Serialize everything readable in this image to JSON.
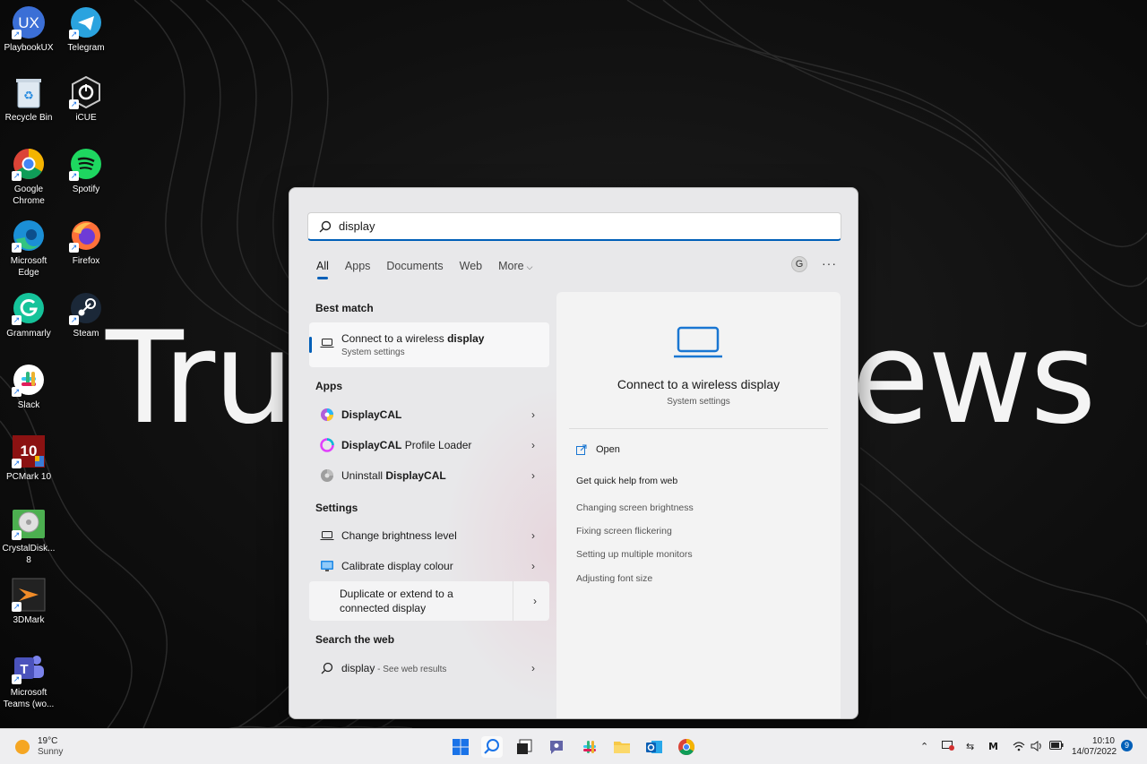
{
  "desktop": {
    "wallpaper_text_left": "Trus",
    "wallpaper_text_right": "ews",
    "icons": [
      {
        "label": "PlaybookUX",
        "icon": "playbookux-icon"
      },
      {
        "label": "Telegram",
        "icon": "telegram-icon"
      },
      {
        "label": "Recycle Bin",
        "icon": "recycle-bin-icon"
      },
      {
        "label": "iCUE",
        "icon": "icue-icon"
      },
      {
        "label": "Google Chrome",
        "icon": "chrome-icon"
      },
      {
        "label": "Spotify",
        "icon": "spotify-icon"
      },
      {
        "label": "Microsoft Edge",
        "icon": "edge-icon"
      },
      {
        "label": "Firefox",
        "icon": "firefox-icon"
      },
      {
        "label": "Grammarly",
        "icon": "grammarly-icon"
      },
      {
        "label": "Steam",
        "icon": "steam-icon"
      },
      {
        "label": "Slack",
        "icon": "slack-icon"
      },
      {
        "label": "PCMark 10",
        "icon": "pcmark-icon"
      },
      {
        "label": "CrystalDisk... 8",
        "icon": "crystaldisk-icon"
      },
      {
        "label": "3DMark",
        "icon": "3dmark-icon"
      },
      {
        "label": "Microsoft Teams (wo...",
        "icon": "teams-icon"
      }
    ],
    "playbook_mark": "UX",
    "pcmark_mark": "10"
  },
  "search": {
    "query": "display",
    "tabs": [
      "All",
      "Apps",
      "Documents",
      "Web",
      "More"
    ],
    "user_initial": "G",
    "more_dots": "···"
  },
  "results": {
    "best_match_header": "Best match",
    "best_match": {
      "title_prefix": "Connect to a wireless ",
      "title_bold": "display",
      "subtitle": "System settings"
    },
    "apps_header": "Apps",
    "apps": [
      {
        "bold": "DisplayCAL",
        "rest": "",
        "prefix": ""
      },
      {
        "bold": "DisplayCAL",
        "rest": " Profile Loader",
        "prefix": ""
      },
      {
        "bold": "DisplayCAL",
        "rest": "",
        "prefix": "Uninstall "
      }
    ],
    "settings_header": "Settings",
    "settings": [
      {
        "label": "Change brightness level"
      },
      {
        "label": "Calibrate display colour"
      }
    ],
    "duplicate": {
      "line1": "Duplicate or extend to a",
      "line2": "connected display"
    },
    "web_header": "Search the web",
    "web": {
      "query": "display",
      "suffix": " - See web results"
    }
  },
  "preview": {
    "title": "Connect to a wireless display",
    "subtitle": "System settings",
    "open_label": "Open",
    "help_header": "Get quick help from web",
    "links": [
      "Changing screen brightness",
      "Fixing screen flickering",
      "Setting up multiple monitors",
      "Adjusting font size"
    ]
  },
  "taskbar": {
    "temp": "19°C",
    "condition": "Sunny",
    "time": "10:10",
    "date": "14/07/2022",
    "notification_count": "9"
  },
  "colors": {
    "accent": "#005fb8",
    "sun": "#f5a623"
  }
}
